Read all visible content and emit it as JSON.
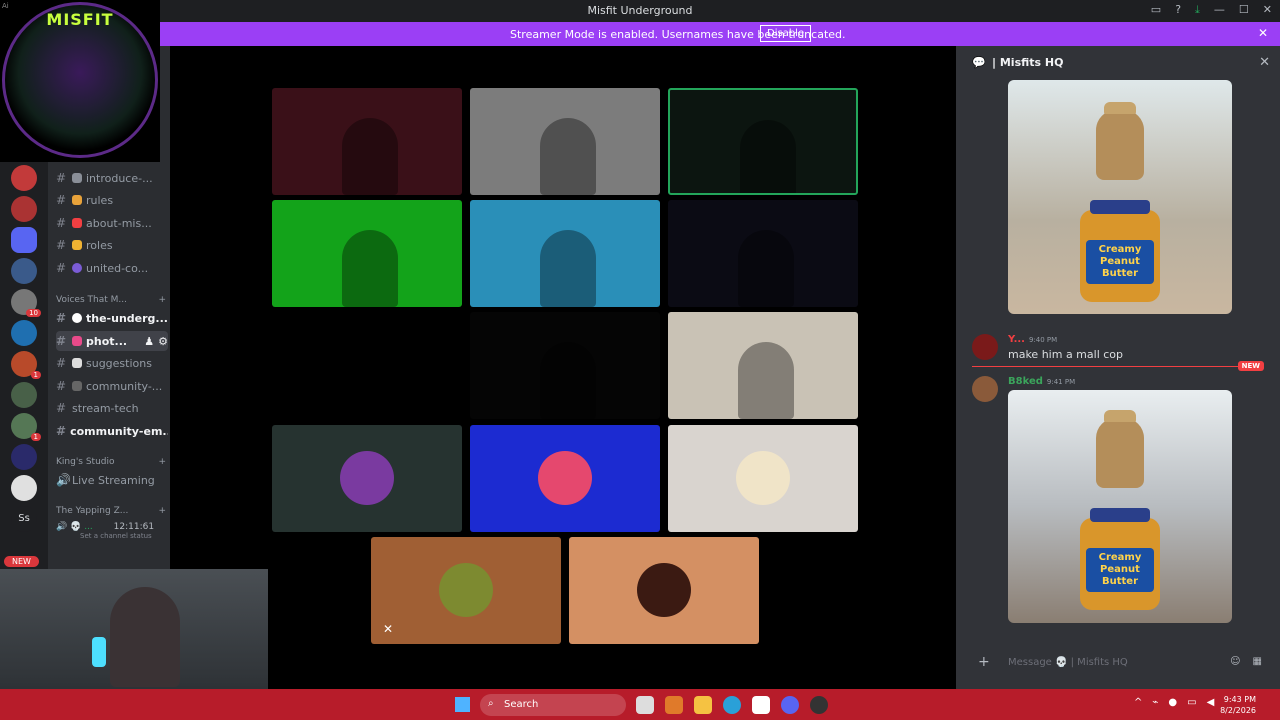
{
  "window": {
    "title": "Misfit Underground",
    "app_tag": "Ai"
  },
  "banner": {
    "message": "Streamer Mode is enabled. Usernames have been truncated.",
    "disable_label": "Disable"
  },
  "channels": {
    "items": [
      {
        "label": "introduce-...",
        "color": "#8a8f98"
      },
      {
        "label": "rules",
        "color": "#e8a23a"
      },
      {
        "label": "about-mis...",
        "color": "#f23f42"
      },
      {
        "label": "roles",
        "color": "#f0b232"
      },
      {
        "label": "united-co...",
        "color": "#7b5cd6"
      }
    ],
    "voice_category": "Voices That M...",
    "voice_items": [
      {
        "label": "the-underg..."
      },
      {
        "label": "phot..."
      },
      {
        "label": "suggestions"
      },
      {
        "label": "community-..."
      },
      {
        "label": "stream-tech"
      },
      {
        "label": "community-em..."
      }
    ],
    "kings_category": "King's Studio",
    "live_streaming": "Live Streaming",
    "yapping_category": "The Yapping Z...",
    "voice_user": {
      "name": "...",
      "time": "12:11:61",
      "status": "Set a channel status"
    }
  },
  "servers": {
    "badge_10": "10",
    "badge_1": "1",
    "initials": "Ss",
    "new_label": "NEW"
  },
  "avatar": {
    "text": "MISFIT"
  },
  "stage": {
    "tiles": [
      {
        "kind": "video",
        "bg": "#3a1018",
        "speaking": false
      },
      {
        "kind": "video",
        "bg": "#7c7c7c",
        "speaking": false
      },
      {
        "kind": "video",
        "bg": "#0c1510",
        "speaking": true
      },
      {
        "kind": "video",
        "bg": "#13a31a",
        "speaking": false
      },
      {
        "kind": "video",
        "bg": "#2a8fb8",
        "speaking": false
      },
      {
        "kind": "video",
        "bg": "#0b0b14",
        "speaking": false
      },
      {
        "kind": "video",
        "bg": "#000000",
        "speaking": false
      },
      {
        "kind": "video",
        "bg": "#050505",
        "speaking": false
      },
      {
        "kind": "video",
        "bg": "#c9c2b5",
        "speaking": false
      },
      {
        "kind": "avatar",
        "bg": "#263330",
        "disc": "#7a3aa0",
        "speaking": false
      },
      {
        "kind": "avatar",
        "bg": "#1c2bd1",
        "disc": "#e5486e",
        "speaking": false
      },
      {
        "kind": "avatar",
        "bg": "#d9d4cf",
        "disc": "#f0e4c8",
        "speaking": false
      },
      {
        "kind": "avatar",
        "bg": "#a05f34",
        "disc": "#7d8a30",
        "speaking": false,
        "muted": true
      },
      {
        "kind": "avatar",
        "bg": "#d49063",
        "disc": "#3b1a12",
        "speaking": false
      }
    ]
  },
  "panel": {
    "title": "| Misfits HQ",
    "jar_label": "Creamy Peanut Butter",
    "message1": {
      "name": "Y...",
      "time": "9:40 PM",
      "text": "make him a mall cop"
    },
    "new_label": "NEW",
    "message2": {
      "name": "B8ked",
      "time": "9:41 PM"
    },
    "composer_placeholder": "Message 💀 | Misfits HQ"
  },
  "taskbar": {
    "search": "Search",
    "time": "9:43 PM",
    "date": "8/2/2026"
  },
  "colors": {
    "banner": "#9b3ff5",
    "taskbar": "#b71c2a",
    "sidebar": "#2b2d31",
    "panel": "#313338",
    "speaking": "#23a55a"
  }
}
